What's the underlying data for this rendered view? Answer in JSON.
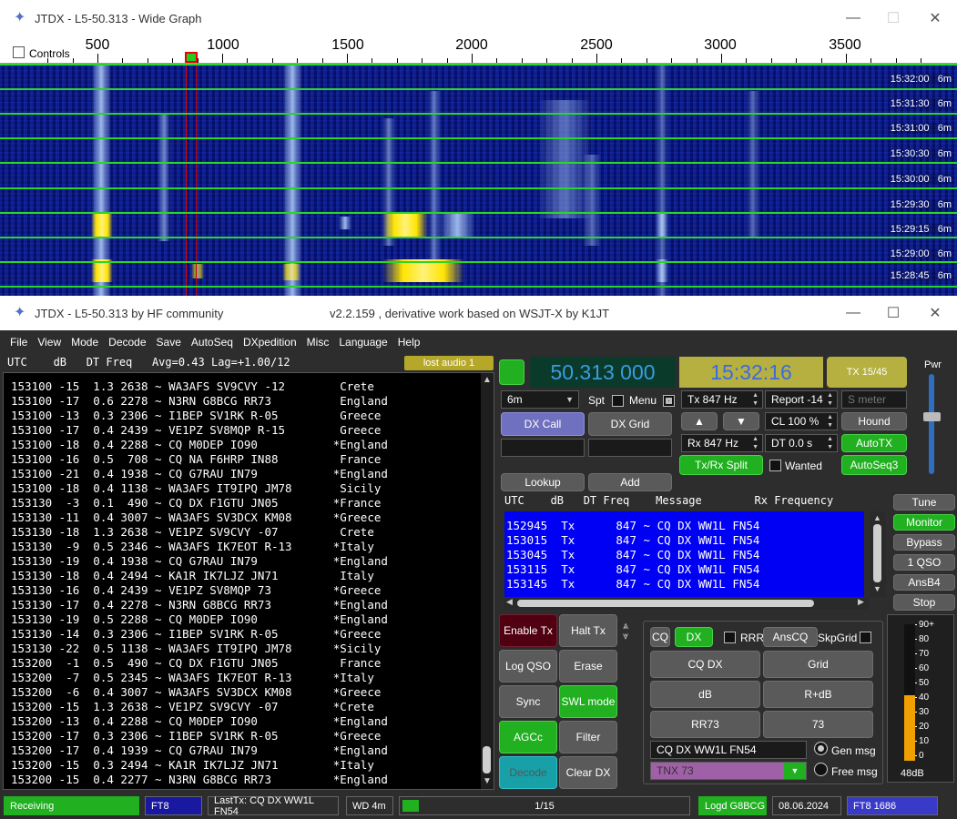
{
  "wide_graph": {
    "title": "JTDX - L5-50.313 - Wide Graph",
    "controls_label": "Controls",
    "freq_labels": [
      "500",
      "1000",
      "1500",
      "2000",
      "2500",
      "3000",
      "3500"
    ],
    "band": "6m",
    "times": [
      "15:32:00",
      "15:31:30",
      "15:31:00",
      "15:30:30",
      "15:30:00",
      "15:29:30",
      "15:29:15",
      "15:29:00",
      "15:28:45"
    ]
  },
  "main": {
    "title": "JTDX - L5-50.313  by HF community",
    "subtitle": "v2.2.159 , derivative work based on WSJT-X by K1JT",
    "menu": [
      "File",
      "View",
      "Mode",
      "Decode",
      "Save",
      "AutoSeq",
      "DXpedition",
      "Misc",
      "Language",
      "Help"
    ],
    "band_header": "UTC    dB   DT Freq   Avg=0.43 Lag=+1.00/12",
    "lost_audio": "lost audio 1",
    "decodes": [
      "153100 -15  1.3 2638 ~ WA3AFS SV9CVY -12        Crete",
      "153100 -17  0.6 2278 ~ N3RN G8BCG RR73          England",
      "153100 -13  0.3 2306 ~ I1BEP SV1RK R-05         Greece",
      "153100 -17  0.4 2439 ~ VE1PZ SV8MQP R-15        Greece",
      "153100 -18  0.4 2288 ~ CQ M0DEP IO90           *England",
      "153100 -16  0.5  708 ~ CQ NA F6HRP IN88         France",
      "153100 -21  0.4 1938 ~ CQ G7RAU IN79           *England",
      "153100 -18  0.4 1138 ~ WA3AFS IT9IPQ JM78       Sicily",
      "153130  -3  0.1  490 ~ CQ DX F1GTU JN05        *France",
      "153130 -11  0.4 3007 ~ WA3AFS SV3DCX KM08      *Greece",
      "153130 -18  1.3 2638 ~ VE1PZ SV9CVY -07         Crete",
      "153130  -9  0.5 2346 ~ WA3AFS IK7EOT R-13      *Italy",
      "153130 -19  0.4 1938 ~ CQ G7RAU IN79           *England",
      "153130 -18  0.4 2494 ~ KA1R IK7LJZ JN71         Italy",
      "153130 -16  0.4 2439 ~ VE1PZ SV8MQP 73         *Greece",
      "153130 -17  0.4 2278 ~ N3RN G8BCG RR73         *England",
      "153130 -19  0.5 2288 ~ CQ M0DEP IO90           *England",
      "153130 -14  0.3 2306 ~ I1BEP SV1RK R-05        *Greece",
      "153130 -22  0.5 1138 ~ WA3AFS IT9IPQ JM78      *Sicily",
      "153200  -1  0.5  490 ~ CQ DX F1GTU JN05         France",
      "153200  -7  0.5 2345 ~ WA3AFS IK7EOT R-13      *Italy",
      "153200  -6  0.4 3007 ~ WA3AFS SV3DCX KM08      *Greece",
      "153200 -15  1.3 2638 ~ VE1PZ SV9CVY -07        *Crete",
      "153200 -13  0.4 2288 ~ CQ M0DEP IO90           *England",
      "153200 -17  0.3 2306 ~ I1BEP SV1RK R-05        *Greece",
      "153200 -17  0.4 1939 ~ CQ G7RAU IN79           *England",
      "153200 -15  0.3 2494 ~ KA1R IK7LJZ JN71        *Italy",
      "153200 -15  0.4 2277 ~ N3RN G8BCG RR73         *England"
    ],
    "frequency": "50.313 000",
    "clock": "15:32:16",
    "tx_period": "TX 15/45",
    "pwr_label": "Pwr",
    "band_select": "6m",
    "spt_label": "Spt",
    "menu_label": "Menu",
    "tx_hz": "Tx  847  Hz",
    "report": "Report -14",
    "s_meter_placeholder": "S meter",
    "cl": "CL  100 %",
    "hound": "Hound",
    "rx_hz": "Rx  847  Hz",
    "dt": "DT 0.0 s",
    "autotx": "AutoTX",
    "dx_call": "DX Call",
    "dx_grid": "DX Grid",
    "txrx_split": "Tx/Rx Split",
    "wanted": "Wanted",
    "autoseq3": "AutoSeq3",
    "lookup": "Lookup",
    "add": "Add",
    "rx_header": "UTC    dB   DT Freq    Message        Rx Frequency",
    "rx_rows": [
      "152945  Tx      847 ~ CQ DX WW1L FN54",
      "153015  Tx      847 ~ CQ DX WW1L FN54",
      "153045  Tx      847 ~ CQ DX WW1L FN54",
      "153115  Tx      847 ~ CQ DX WW1L FN54",
      "153145  Tx      847 ~ CQ DX WW1L FN54"
    ],
    "right_buttons": [
      "Tune",
      "Monitor",
      "Bypass",
      "1 QSO",
      "AnsB4",
      "Stop"
    ],
    "enable_tx": "Enable Tx",
    "halt_tx": "Halt Tx",
    "log_qso": "Log QSO",
    "erase": "Erase",
    "sync": "Sync",
    "swl_mode": "SWL mode",
    "agcc": "AGCc",
    "filter": "Filter",
    "decode": "Decode",
    "clear_dx": "Clear DX",
    "cq": "CQ",
    "dx": "DX",
    "rrr": "RRR",
    "anscq": "AnsCQ",
    "skpgrid": "SkpGrid",
    "msg_buttons": [
      "CQ DX",
      "Grid",
      "dB",
      "R+dB",
      "RR73",
      "73"
    ],
    "gen_msg_text": "CQ DX WW1L FN54",
    "free_msg_text": "TNX 73",
    "gen_msg": "Gen msg",
    "free_msg": "Free msg",
    "meter_scale": [
      "90+",
      "80",
      "70",
      "60",
      "50",
      "40",
      "30",
      "20",
      "10",
      "0"
    ],
    "meter_db": "48dB",
    "meter_level": 0.48,
    "status": {
      "receiving": "Receiving",
      "mode": "FT8",
      "lasttx": "LastTx: CQ DX WW1L FN54",
      "wd": "WD 4m",
      "progress": "1/15",
      "logd": "Logd G8BCG",
      "date": "08.06.2024",
      "mode_freq": "FT8  1686"
    }
  },
  "colors": {
    "green": "#20b020",
    "freq_bg": "#0a3a2a",
    "freq_text": "#3b9bdf",
    "clock_bg": "#b5b040",
    "rx_bg": "#0000f5",
    "status_blue": "#1818a0"
  }
}
